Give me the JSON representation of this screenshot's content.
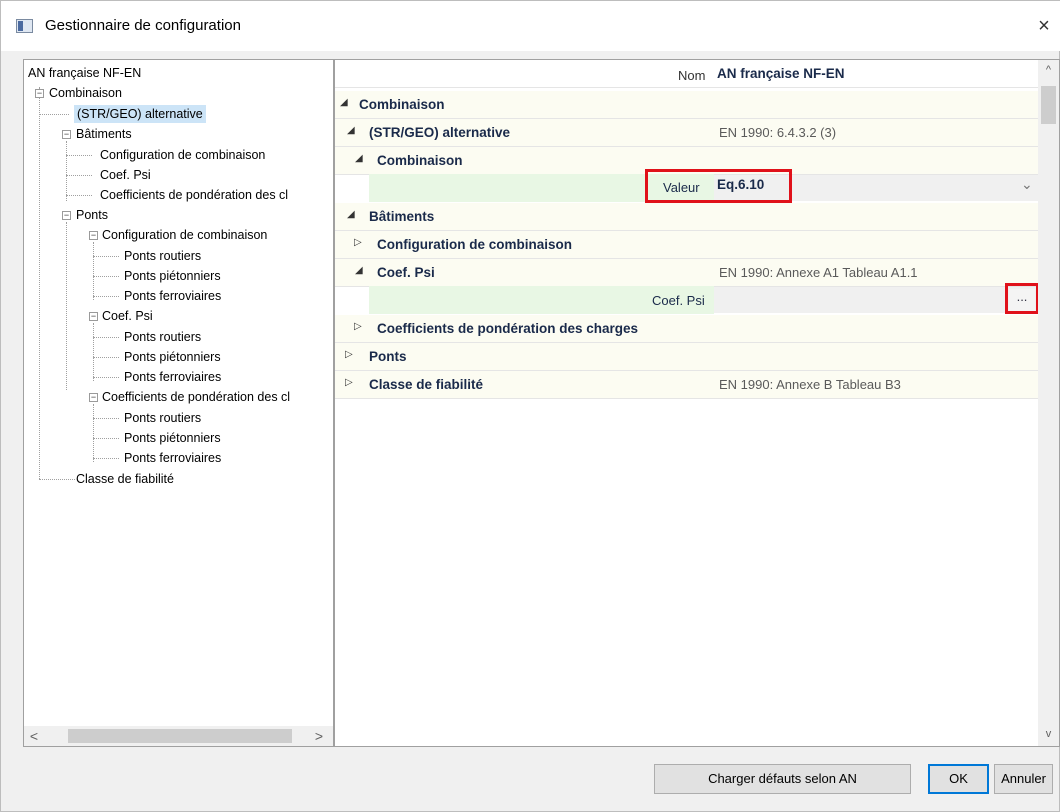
{
  "window": {
    "title": "Gestionnaire de configuration",
    "close_label": "×"
  },
  "tree": {
    "root": "AN française NF-EN",
    "combinaison": "Combinaison",
    "str_geo": "(STR/GEO) alternative",
    "batiments": "Bâtiments",
    "bat_config": "Configuration de combinaison",
    "bat_psi": "Coef. Psi",
    "bat_coef": "Coefficients de pondération des cl",
    "ponts": "Ponts",
    "ponts_config": "Configuration de combinaison",
    "pc_routiers": "Ponts routiers",
    "pc_pietonniers": "Ponts piétonniers",
    "pc_ferroviaires": "Ponts ferroviaires",
    "ponts_psi": "Coef. Psi",
    "pp_routiers": "Ponts routiers",
    "pp_pietonniers": "Ponts piétonniers",
    "pp_ferroviaires": "Ponts ferroviaires",
    "ponts_coef": "Coefficients de pondération des cl",
    "pk_routiers": "Ponts routiers",
    "pk_pietonniers": "Ponts piétonniers",
    "pk_ferroviaires": "Ponts ferroviaires",
    "fiabilite": "Classe de fiabilité",
    "scroll_left": "<",
    "scroll_right": ">"
  },
  "grid": {
    "nom_label": "Nom",
    "nom_value": "AN française NF-EN",
    "cat_combinaison": "Combinaison",
    "str_geo": "(STR/GEO) alternative",
    "str_geo_ref": "EN 1990: 6.4.3.2 (3)",
    "sub_combinaison": "Combinaison",
    "valeur_label": "Valeur",
    "valeur_value": "Eq.6.10",
    "dropdown_glyph": "⌄",
    "cat_batiments": "Bâtiments",
    "config": "Configuration de combinaison",
    "coef_psi": "Coef. Psi",
    "coef_psi_ref": "EN 1990: Annexe A1 Tableau A1.1",
    "coef_psi_label": "Coef. Psi",
    "ellipsis": "...",
    "coef_pond": "Coefficients de pondération des charges",
    "cat_ponts": "Ponts",
    "cat_fiabilite": "Classe de fiabilité",
    "fiabilite_ref": "EN 1990: Annexe B Tableau B3",
    "tri_open": "◢",
    "tri_closed": "▷",
    "scroll_up": "^",
    "scroll_down": "v"
  },
  "buttons": {
    "load_defaults": "Charger défauts selon AN",
    "ok": "OK",
    "cancel": "Annuler"
  },
  "colors": {
    "highlight": "#e0111a",
    "selection": "#cce4f7",
    "edit_bg": "#e8f7e4"
  }
}
